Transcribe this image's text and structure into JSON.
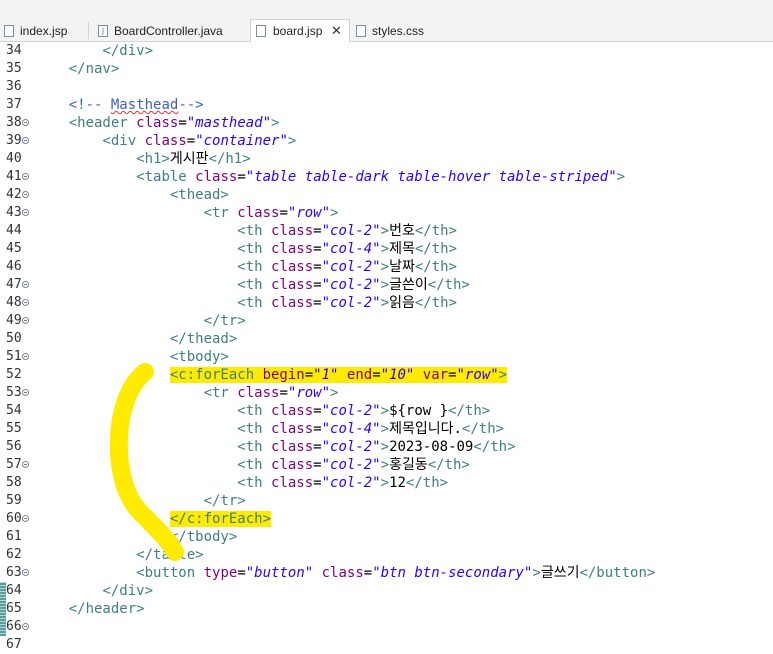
{
  "tabs": [
    {
      "label": "index.jsp",
      "icon": "jsp-file-icon",
      "active": false
    },
    {
      "label": "BoardController.java",
      "icon": "java-file-icon",
      "active": false
    },
    {
      "label": "board.jsp",
      "icon": "jsp-file-icon",
      "active": true,
      "close": "✕"
    },
    {
      "label": "styles.css",
      "icon": "css-file-icon",
      "active": false
    }
  ],
  "colors": {
    "tag": "#3f7f7f",
    "attribute": "#7f007f",
    "string": "#2a00ff",
    "comment": "#3f5fbf",
    "highlight": "#ffeb00"
  },
  "lines": [
    {
      "n": "34",
      "fold": false,
      "indent": "        ",
      "segs": [
        [
          "tag",
          "</div>"
        ]
      ]
    },
    {
      "n": "35",
      "fold": false,
      "indent": "    ",
      "segs": [
        [
          "tag",
          "</nav>"
        ]
      ]
    },
    {
      "n": "36",
      "fold": false,
      "indent": "",
      "segs": []
    },
    {
      "n": "37",
      "fold": false,
      "indent": "    ",
      "segs": [
        [
          "cmt",
          "<!-- "
        ],
        [
          "cmterr",
          "Masthead"
        ],
        [
          "cmt",
          "-->"
        ]
      ]
    },
    {
      "n": "38",
      "fold": true,
      "indent": "    ",
      "segs": [
        [
          "tag",
          "<header "
        ],
        [
          "attr",
          "class"
        ],
        [
          "txt",
          "="
        ],
        [
          "str",
          "\"masthead\""
        ],
        [
          "tag",
          ">"
        ]
      ]
    },
    {
      "n": "39",
      "fold": true,
      "indent": "        ",
      "segs": [
        [
          "tag",
          "<div "
        ],
        [
          "attr",
          "class"
        ],
        [
          "txt",
          "="
        ],
        [
          "str",
          "\"container\""
        ],
        [
          "tag",
          ">"
        ]
      ]
    },
    {
      "n": "40",
      "fold": false,
      "indent": "            ",
      "segs": [
        [
          "tag",
          "<h1>"
        ],
        [
          "txt",
          "게시판"
        ],
        [
          "tag",
          "</h1>"
        ]
      ]
    },
    {
      "n": "41",
      "fold": true,
      "indent": "            ",
      "segs": [
        [
          "tag",
          "<table "
        ],
        [
          "attr",
          "class"
        ],
        [
          "txt",
          "="
        ],
        [
          "str",
          "\"table table-dark table-hover table-striped\""
        ],
        [
          "tag",
          ">"
        ]
      ]
    },
    {
      "n": "42",
      "fold": true,
      "indent": "                ",
      "segs": [
        [
          "tag",
          "<thead>"
        ]
      ]
    },
    {
      "n": "43",
      "fold": true,
      "indent": "                    ",
      "segs": [
        [
          "tag",
          "<tr "
        ],
        [
          "attr",
          "class"
        ],
        [
          "txt",
          "="
        ],
        [
          "str",
          "\"row\""
        ],
        [
          "tag",
          ">"
        ]
      ]
    },
    {
      "n": "44",
      "fold": false,
      "indent": "                        ",
      "segs": [
        [
          "tag",
          "<th "
        ],
        [
          "attr",
          "class"
        ],
        [
          "txt",
          "="
        ],
        [
          "str",
          "\"col-2\""
        ],
        [
          "tag",
          ">"
        ],
        [
          "txt",
          "번호"
        ],
        [
          "tag",
          "</th>"
        ]
      ]
    },
    {
      "n": "45",
      "fold": false,
      "indent": "                        ",
      "segs": [
        [
          "tag",
          "<th "
        ],
        [
          "attr",
          "class"
        ],
        [
          "txt",
          "="
        ],
        [
          "str",
          "\"col-4\""
        ],
        [
          "tag",
          ">"
        ],
        [
          "txt",
          "제목"
        ],
        [
          "tag",
          "</th>"
        ]
      ]
    },
    {
      "n": "46",
      "fold": false,
      "indent": "                        ",
      "segs": [
        [
          "tag",
          "<th "
        ],
        [
          "attr",
          "class"
        ],
        [
          "txt",
          "="
        ],
        [
          "str",
          "\"col-2\""
        ],
        [
          "tag",
          ">"
        ],
        [
          "txt",
          "날짜"
        ],
        [
          "tag",
          "</th>"
        ]
      ]
    },
    {
      "n": "47",
      "fold": true,
      "indent": "                        ",
      "segs": [
        [
          "tag",
          "<th "
        ],
        [
          "attr",
          "class"
        ],
        [
          "txt",
          "="
        ],
        [
          "str",
          "\"col-2\""
        ],
        [
          "tag",
          ">"
        ],
        [
          "txt",
          "글쓴이"
        ],
        [
          "tag",
          "</th>"
        ]
      ]
    },
    {
      "n": "48",
      "fold": true,
      "indent": "                        ",
      "segs": [
        [
          "tag",
          "<th "
        ],
        [
          "attr",
          "class"
        ],
        [
          "txt",
          "="
        ],
        [
          "str",
          "\"col-2\""
        ],
        [
          "tag",
          ">"
        ],
        [
          "txt",
          "읽음"
        ],
        [
          "tag",
          "</th>"
        ]
      ]
    },
    {
      "n": "49",
      "fold": true,
      "indent": "                    ",
      "segs": [
        [
          "tag",
          "</tr>"
        ]
      ]
    },
    {
      "n": "50",
      "fold": false,
      "indent": "                ",
      "segs": [
        [
          "tag",
          "</thead>"
        ]
      ]
    },
    {
      "n": "51",
      "fold": true,
      "indent": "                ",
      "segs": [
        [
          "tag",
          "<tbody>"
        ]
      ]
    },
    {
      "n": "52",
      "fold": false,
      "indent": "                ",
      "hl": true,
      "segs": [
        [
          "tag",
          "<c:forEach "
        ],
        [
          "attr",
          "begin"
        ],
        [
          "txt",
          "="
        ],
        [
          "str",
          "\"1\""
        ],
        [
          "txt",
          " "
        ],
        [
          "attr",
          "end"
        ],
        [
          "txt",
          "="
        ],
        [
          "str",
          "\"10\""
        ],
        [
          "txt",
          " "
        ],
        [
          "attr",
          "var"
        ],
        [
          "txt",
          "="
        ],
        [
          "str",
          "\"row\""
        ],
        [
          "tag",
          ">"
        ]
      ]
    },
    {
      "n": "53",
      "fold": true,
      "indent": "                    ",
      "segs": [
        [
          "tag",
          "<tr "
        ],
        [
          "attr",
          "class"
        ],
        [
          "txt",
          "="
        ],
        [
          "str",
          "\"row\""
        ],
        [
          "tag",
          ">"
        ]
      ]
    },
    {
      "n": "54",
      "fold": false,
      "indent": "                        ",
      "segs": [
        [
          "tag",
          "<th "
        ],
        [
          "attr",
          "class"
        ],
        [
          "txt",
          "="
        ],
        [
          "str",
          "\"col-2\""
        ],
        [
          "tag",
          ">"
        ],
        [
          "txt",
          "${row }"
        ],
        [
          "tag",
          "</th>"
        ]
      ]
    },
    {
      "n": "55",
      "fold": false,
      "indent": "                        ",
      "segs": [
        [
          "tag",
          "<th "
        ],
        [
          "attr",
          "class"
        ],
        [
          "txt",
          "="
        ],
        [
          "str",
          "\"col-4\""
        ],
        [
          "tag",
          ">"
        ],
        [
          "txt",
          "제목입니다."
        ],
        [
          "tag",
          "</th>"
        ]
      ]
    },
    {
      "n": "56",
      "fold": false,
      "indent": "                        ",
      "segs": [
        [
          "tag",
          "<th "
        ],
        [
          "attr",
          "class"
        ],
        [
          "txt",
          "="
        ],
        [
          "str",
          "\"col-2\""
        ],
        [
          "tag",
          ">"
        ],
        [
          "txt",
          "2023-08-09"
        ],
        [
          "tag",
          "</th>"
        ]
      ]
    },
    {
      "n": "57",
      "fold": true,
      "indent": "                        ",
      "segs": [
        [
          "tag",
          "<th "
        ],
        [
          "attr",
          "class"
        ],
        [
          "txt",
          "="
        ],
        [
          "str",
          "\"col-2\""
        ],
        [
          "tag",
          ">"
        ],
        [
          "txt",
          "홍길동"
        ],
        [
          "tag",
          "</th>"
        ]
      ]
    },
    {
      "n": "58",
      "fold": false,
      "indent": "                        ",
      "segs": [
        [
          "tag",
          "<th "
        ],
        [
          "attr",
          "class"
        ],
        [
          "txt",
          "="
        ],
        [
          "str",
          "\"col-2\""
        ],
        [
          "tag",
          ">"
        ],
        [
          "txt",
          "12"
        ],
        [
          "tag",
          "</th>"
        ]
      ]
    },
    {
      "n": "59",
      "fold": false,
      "indent": "                    ",
      "segs": [
        [
          "tag",
          "</tr>"
        ]
      ]
    },
    {
      "n": "60",
      "fold": true,
      "indent": "                ",
      "hl": true,
      "segs": [
        [
          "tag",
          "</c:forEach>"
        ]
      ]
    },
    {
      "n": "61",
      "fold": false,
      "indent": "                ",
      "segs": [
        [
          "tag",
          "</tbody>"
        ]
      ]
    },
    {
      "n": "62",
      "fold": false,
      "indent": "            ",
      "segs": [
        [
          "tag",
          "</table>"
        ]
      ]
    },
    {
      "n": "63",
      "fold": true,
      "indent": "            ",
      "segs": [
        [
          "tag",
          "<button "
        ],
        [
          "attr",
          "type"
        ],
        [
          "txt",
          "="
        ],
        [
          "str",
          "\"button\""
        ],
        [
          "txt",
          " "
        ],
        [
          "attr",
          "class"
        ],
        [
          "txt",
          "="
        ],
        [
          "str",
          "\"btn btn-secondary\""
        ],
        [
          "tag",
          ">"
        ],
        [
          "txt",
          "글쓰기"
        ],
        [
          "tag",
          "</button>"
        ]
      ]
    },
    {
      "n": "64",
      "fold": false,
      "indent": "        ",
      "segs": [
        [
          "tag",
          "</div>"
        ]
      ]
    },
    {
      "n": "65",
      "fold": false,
      "indent": "    ",
      "segs": [
        [
          "tag",
          "</header>"
        ]
      ]
    },
    {
      "n": "66",
      "fold": true,
      "indent": "",
      "segs": []
    },
    {
      "n": "67",
      "fold": false,
      "indent": "",
      "segs": []
    }
  ]
}
